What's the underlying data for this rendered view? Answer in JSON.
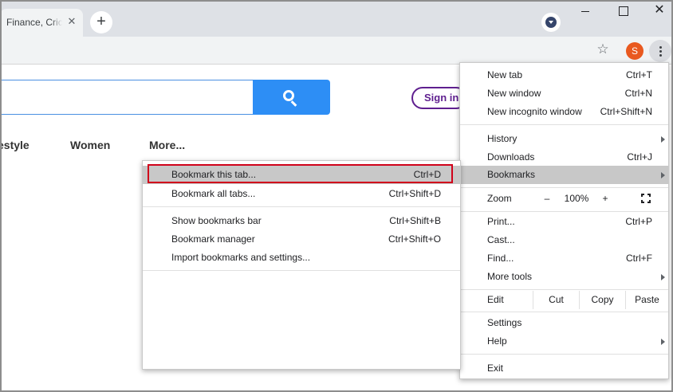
{
  "browser": {
    "tab_title": "Finance, Cricket",
    "tab_close_glyph": "✕",
    "new_tab_glyph": "+",
    "close_glyph": "✕",
    "avatar_letter": "S",
    "star_glyph": "☆"
  },
  "page": {
    "signin_label": "Sign in",
    "nav": [
      "estyle",
      "Women",
      "More..."
    ]
  },
  "menu": {
    "new_tab": {
      "label": "New tab",
      "shortcut": "Ctrl+T"
    },
    "new_window": {
      "label": "New window",
      "shortcut": "Ctrl+N"
    },
    "incognito": {
      "label": "New incognito window",
      "shortcut": "Ctrl+Shift+N"
    },
    "history": {
      "label": "History"
    },
    "downloads": {
      "label": "Downloads",
      "shortcut": "Ctrl+J"
    },
    "bookmarks": {
      "label": "Bookmarks"
    },
    "zoom": {
      "label": "Zoom",
      "minus": "–",
      "level": "100%",
      "plus": "+"
    },
    "print": {
      "label": "Print...",
      "shortcut": "Ctrl+P"
    },
    "cast": {
      "label": "Cast..."
    },
    "find": {
      "label": "Find...",
      "shortcut": "Ctrl+F"
    },
    "more_tools": {
      "label": "More tools"
    },
    "edit": {
      "label": "Edit",
      "cut": "Cut",
      "copy": "Copy",
      "paste": "Paste"
    },
    "settings": {
      "label": "Settings"
    },
    "help": {
      "label": "Help"
    },
    "exit": {
      "label": "Exit"
    }
  },
  "bookmarks_submenu": {
    "bookmark_tab": {
      "label": "Bookmark this tab...",
      "shortcut": "Ctrl+D"
    },
    "bookmark_all": {
      "label": "Bookmark all tabs...",
      "shortcut": "Ctrl+Shift+D"
    },
    "show_bar": {
      "label": "Show bookmarks bar",
      "shortcut": "Ctrl+Shift+B"
    },
    "manager": {
      "label": "Bookmark manager",
      "shortcut": "Ctrl+Shift+O"
    },
    "import": {
      "label": "Import bookmarks and settings..."
    }
  },
  "colors": {
    "search_button": "#2d8ef5",
    "signin": "#5f1f8f",
    "avatar": "#e9591f",
    "highlight_border": "#d0021b"
  }
}
